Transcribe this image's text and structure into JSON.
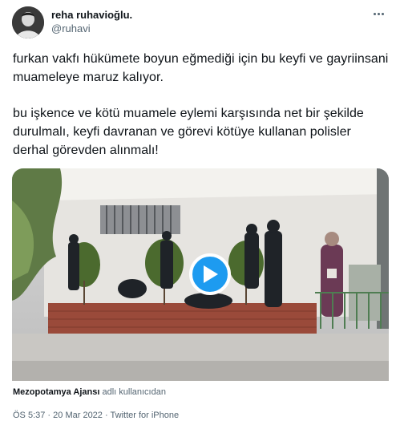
{
  "author": {
    "display_name": "reha ruhavioğlu.",
    "handle": "@ruhavi"
  },
  "tweet": {
    "paragraphs": [
      "furkan vakfı hükümete boyun eğmediği için bu keyfi ve gayriinsani muameleye maruz kalıyor.",
      "bu işkence ve kötü muamele eylemi karşısında net bir şekilde durulmalı, keyfi davranan ve görevi kötüye kullanan polisler derhal görevden alınmalı!"
    ]
  },
  "media": {
    "type": "video",
    "attribution_source": "Mezopotamya Ajansı",
    "attribution_suffix": "adlı kullanıcıdan"
  },
  "meta": {
    "time": "ÖS 5:37",
    "separator": "·",
    "date": "20 Mar 2022",
    "client": "Twitter for iPhone"
  },
  "icons": {
    "more": "more-dots-icon",
    "play": "play-icon"
  },
  "colors": {
    "accent": "#1d9bf0",
    "text_primary": "#0f1419",
    "text_secondary": "#536471"
  }
}
